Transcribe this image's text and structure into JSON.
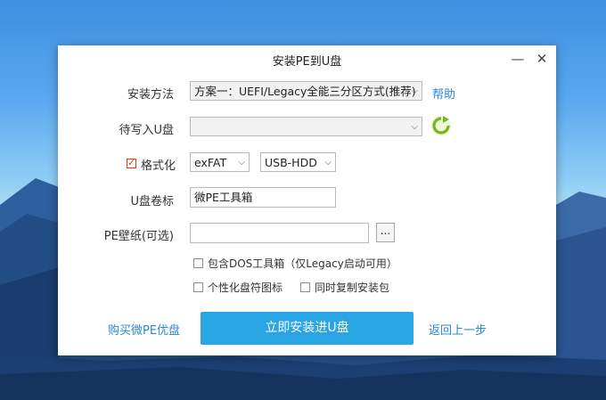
{
  "window": {
    "title": "安装PE到U盘",
    "minimize_glyph": "—",
    "close_glyph": "✕"
  },
  "form": {
    "method_label": "安装方法",
    "method_value": "方案一：UEFI/Legacy全能三分区方式(推荐)",
    "help_link": "帮助",
    "target_label": "待写入U盘",
    "target_value": "",
    "format_label": "格式化",
    "format_checked": true,
    "fs_value": "exFAT",
    "mode_value": "USB-HDD",
    "volume_label": "U盘卷标",
    "volume_value": "微PE工具箱",
    "wallpaper_label": "PE壁纸(可选)",
    "wallpaper_value": "",
    "browse_label": "...",
    "dos_option": "包含DOS工具箱（仅Legacy启动可用）",
    "icon_option": "个性化盘符图标",
    "copy_option": "同时复制安装包"
  },
  "footer": {
    "buy_link": "购买微PE优盘",
    "install_button": "立即安装进U盘",
    "back_link": "返回上一步"
  },
  "icons": {
    "refresh": "refresh-icon",
    "dropdown": "chevron-down-icon"
  },
  "colors": {
    "accent": "#29a5e3",
    "link": "#2b87d8",
    "refresh": "#6fb81e"
  }
}
